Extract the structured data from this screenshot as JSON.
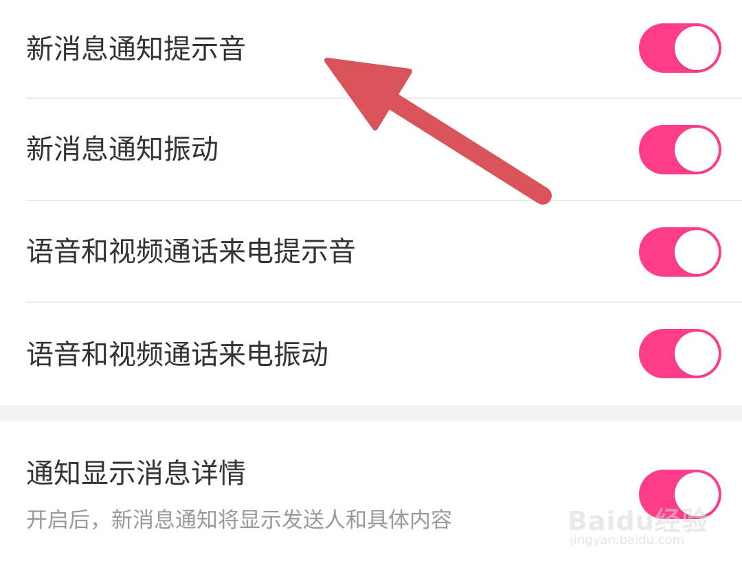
{
  "settings": {
    "items": [
      {
        "label": "新消息通知提示音",
        "enabled": true
      },
      {
        "label": "新消息通知振动",
        "enabled": true
      },
      {
        "label": "语音和视频通话来电提示音",
        "enabled": true
      },
      {
        "label": "语音和视频通话来电振动",
        "enabled": true
      }
    ],
    "detail_item": {
      "label": "通知显示消息详情",
      "description": "开启后，新消息通知将显示发送人和具体内容",
      "enabled": true
    }
  },
  "colors": {
    "toggle_on": "#ff3d8b",
    "annotation_arrow": "#d95459",
    "label_text": "#333333",
    "description_text": "#9a9a9a",
    "section_gap": "#f3f3f3"
  },
  "watermark": {
    "logo": "Baidu经验",
    "url": "jingyan.baidu.com"
  }
}
